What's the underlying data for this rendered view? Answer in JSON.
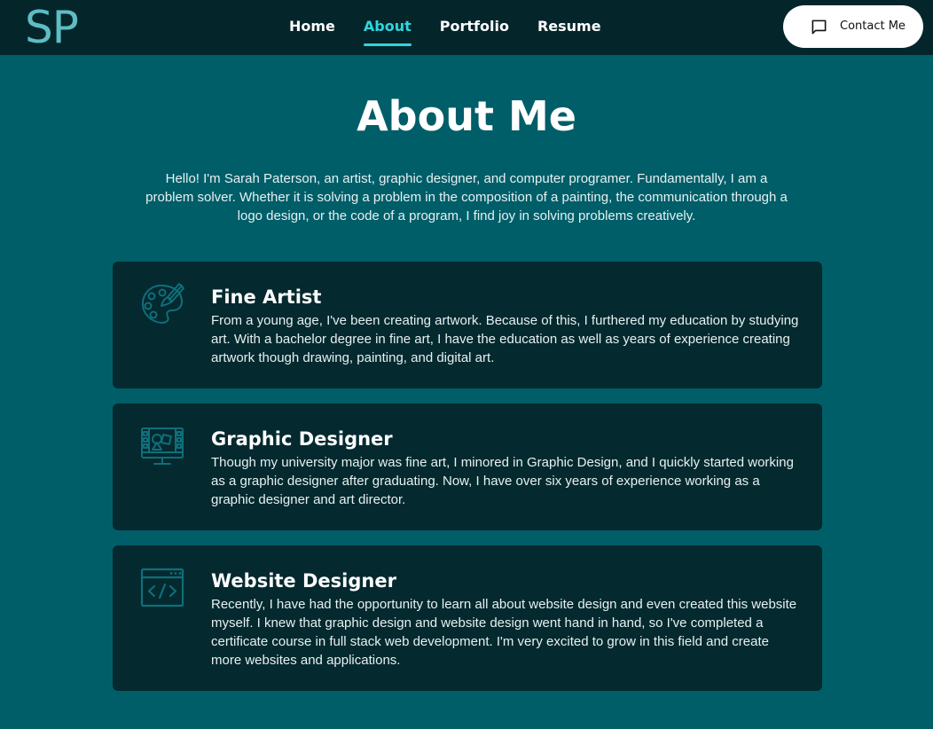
{
  "nav": {
    "logo": "SP",
    "links": [
      {
        "label": "Home",
        "active": false
      },
      {
        "label": "About",
        "active": true
      },
      {
        "label": "Portfolio",
        "active": false
      },
      {
        "label": "Resume",
        "active": false
      }
    ],
    "contact_label": "Contact Me",
    "contact_icon": "message-square-icon"
  },
  "about": {
    "title": "About Me",
    "intro": "Hello! I'm Sarah Paterson, an artist, graphic designer, and computer programer. Fundamentally, I am a problem solver. Whether it is solving a problem in the composition of a painting, the communication through a logo design, or the code of a program, I find joy in solving problems creatively."
  },
  "cards": [
    {
      "icon": "palette-icon",
      "title": "Fine Artist",
      "text": "From a young age, I've been creating artwork. Because of this, I furthered my education by studying art. With a bachelor degree in fine art, I have the education as well as years of experience creating artwork though drawing, painting, and digital art."
    },
    {
      "icon": "design-monitor-icon",
      "title": "Graphic Designer",
      "text": "Though my university major was fine art, I minored in Graphic Design, and I quickly started working as a graphic designer after graduating. Now, I have over six years of experience working as a graphic designer and art director."
    },
    {
      "icon": "code-window-icon",
      "title": "Website Designer",
      "text": "Recently, I have had the opportunity to learn all about website design and even created this website myself. I knew that graphic design and website design went hand in hand, so I've completed a certificate course in full stack web development. I'm very excited to grow in this field and create more websites and applications."
    }
  ],
  "colors": {
    "background": "#005e69",
    "navbar": "#04262b",
    "card": "#04292f",
    "accent": "#30d5dd",
    "logo": "#5fbcc4",
    "icon": "#0e6f7a"
  }
}
